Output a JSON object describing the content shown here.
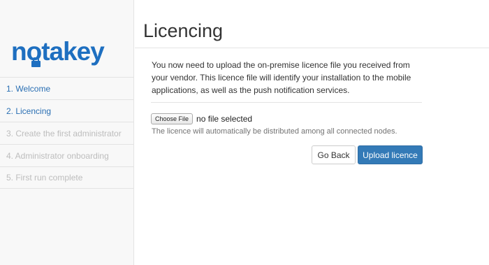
{
  "logo": {
    "text": "notakey"
  },
  "steps": [
    {
      "label": "1. Welcome",
      "state": "active"
    },
    {
      "label": "2. Licencing",
      "state": "active"
    },
    {
      "label": "3. Create the first administrator",
      "state": "disabled"
    },
    {
      "label": "4. Administrator onboarding",
      "state": "disabled"
    },
    {
      "label": "5. First run complete",
      "state": "disabled"
    }
  ],
  "page": {
    "title": "Licencing",
    "intro": "You now need to upload the on-premise licence file you received from your vendor. This licence file will identify your installation to the mobile applications, as well as the push notification services.",
    "file_button": "Choose File",
    "file_status": "no file selected",
    "help": "The licence will automatically be distributed among all connected nodes.",
    "back_label": "Go Back",
    "upload_label": "Upload licence"
  },
  "colors": {
    "brand": "#1e6fc0",
    "primary": "#337ab7",
    "step_active": "#2a6fb3",
    "step_disabled": "#bdbdbd"
  }
}
